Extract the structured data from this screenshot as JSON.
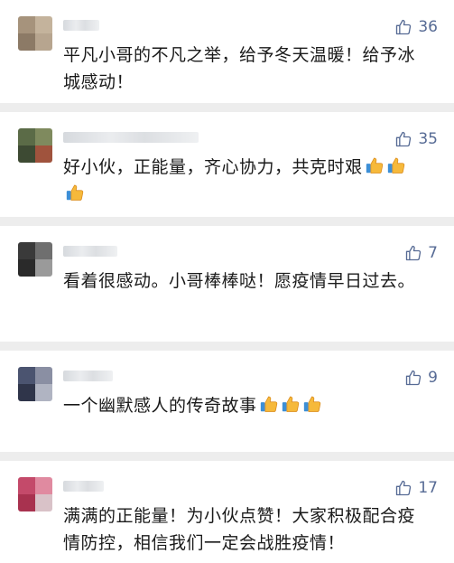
{
  "comments": [
    {
      "likes": "36",
      "text": "平凡小哥的不凡之举，给予冬天温暖！给予冰城感动！",
      "emoji_count": 0,
      "avatar_colors": [
        "#a6937c",
        "#c4b39c",
        "#8c7a66",
        "#b7a58f"
      ],
      "name_width": 40
    },
    {
      "likes": "35",
      "text": "好小伙，正能量，齐心协力，共克时艰",
      "emoji_count": 3,
      "avatar_colors": [
        "#5b6b47",
        "#7f8a5e",
        "#3d4a33",
        "#a0533d"
      ],
      "name_width": 150
    },
    {
      "likes": "7",
      "text": "看着很感动。小哥棒棒哒！愿疫情早日过去。",
      "emoji_count": 0,
      "avatar_colors": [
        "#3a3a3a",
        "#6f6f6f",
        "#2a2a2a",
        "#9a9a9a"
      ],
      "name_width": 60
    },
    {
      "likes": "9",
      "text": "一个幽默感人的传奇故事",
      "emoji_count": 3,
      "avatar_colors": [
        "#4b5470",
        "#8a8fa3",
        "#2f354a",
        "#b0b4c2"
      ],
      "name_width": 55
    },
    {
      "likes": "17",
      "text": "满满的正能量！为小伙点赞！大家积极配合疫情防控，相信我们一定会战胜疫情！",
      "emoji_count": 0,
      "avatar_colors": [
        "#c44a6a",
        "#e08aa0",
        "#a8324f",
        "#d9c2c8"
      ],
      "name_width": 45
    }
  ],
  "colors": {
    "like": "#576b95",
    "background": "#ededed",
    "card": "#ffffff"
  },
  "icons": {
    "like": "thumbs-up-outline-icon",
    "emoji": "thumbs-up-emoji-icon"
  }
}
